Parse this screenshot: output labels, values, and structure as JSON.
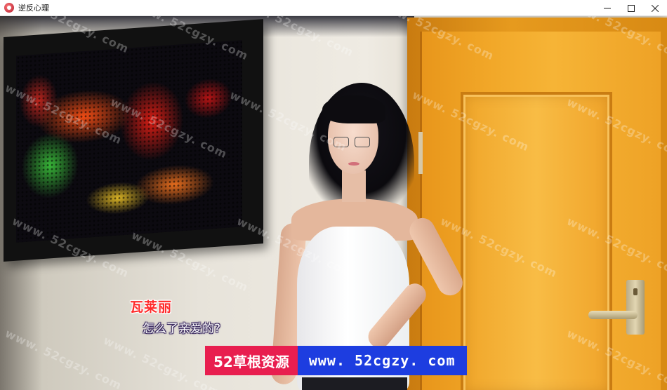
{
  "window": {
    "title": "逆反心理",
    "icon": "app-logo-icon",
    "controls": [
      "minimize-icon",
      "maximize-icon",
      "close-icon"
    ]
  },
  "dialogue": {
    "speaker": "瓦莱丽",
    "text": "怎么了亲爱的?",
    "speaker_color": "#ff2a2a"
  },
  "banner": {
    "left_text": "52草根资源",
    "right_text": "www. 52cgzy. com",
    "left_color": "#e81e4f",
    "right_color": "#1d3de0"
  },
  "watermark": {
    "text": "www. 52cgzy. com"
  }
}
